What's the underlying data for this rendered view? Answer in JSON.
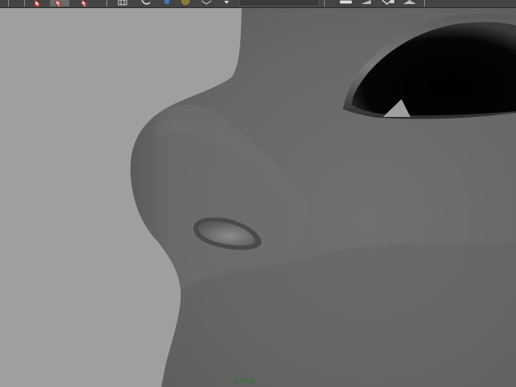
{
  "viewport": {
    "camera_name": "persp",
    "background_color": "#9f9f9f",
    "mesh_color": "#6a6a6a"
  },
  "toolbar": {
    "tools": [
      {
        "name": "select-tool-icon"
      },
      {
        "name": "lasso-tool-icon"
      },
      {
        "name": "paint-select-tool-icon"
      },
      {
        "name": "grid-icon"
      },
      {
        "name": "magnet-curve-icon"
      },
      {
        "name": "snap-point-icon"
      },
      {
        "name": "snap-surface-icon"
      },
      {
        "name": "render-view-icon"
      },
      {
        "name": "render-frame-icon"
      },
      {
        "name": "ipr-render-icon"
      },
      {
        "name": "render-settings-icon"
      }
    ]
  }
}
